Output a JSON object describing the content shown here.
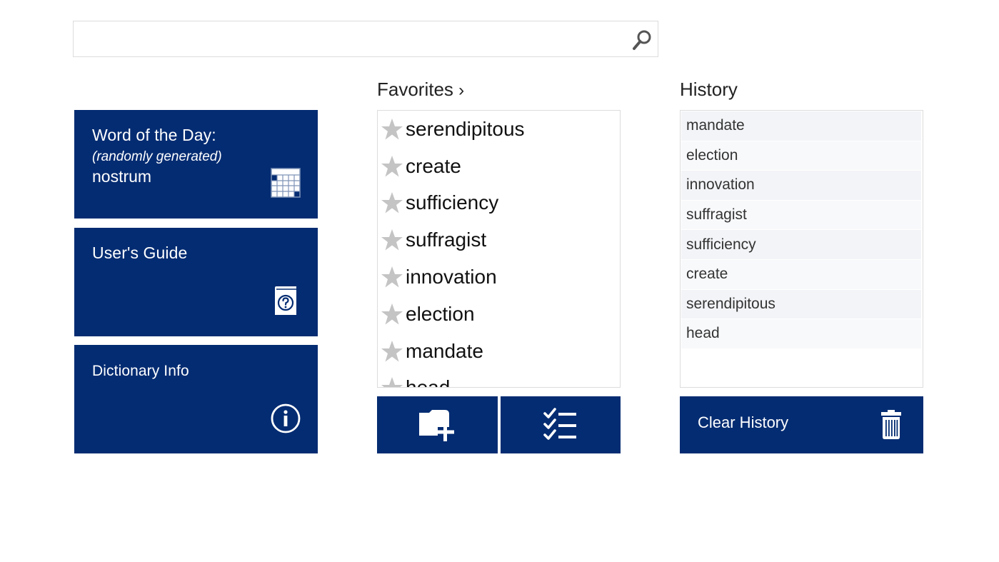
{
  "search": {
    "value": "",
    "placeholder": "",
    "icon": "search-icon"
  },
  "tiles": {
    "word_of_day": {
      "title": "Word of the Day:",
      "subtitle": "(randomly generated)",
      "word": "nostrum",
      "icon": "calendar-icon"
    },
    "users_guide": {
      "title": "User's Guide",
      "icon": "help-book-icon"
    },
    "dictionary_info": {
      "title": "Dictionary Info",
      "icon": "info-icon"
    }
  },
  "favorites": {
    "heading": "Favorites",
    "chevron": "›",
    "items": [
      "serendipitous",
      "create",
      "sufficiency",
      "suffragist",
      "innovation",
      "election",
      "mandate",
      "head"
    ],
    "star_color": "#c4c4c4",
    "buttons": {
      "add_folder_icon": "folder-add-icon",
      "manage_icon": "checklist-icon"
    }
  },
  "history": {
    "heading": "History",
    "items": [
      "mandate",
      "election",
      "innovation",
      "suffragist",
      "sufficiency",
      "create",
      "serendipitous",
      "head"
    ],
    "clear_label": "Clear History",
    "clear_icon": "trash-icon"
  },
  "colors": {
    "accent": "#042c72",
    "tile_text": "#ffffff",
    "border": "#dcdcdc"
  }
}
